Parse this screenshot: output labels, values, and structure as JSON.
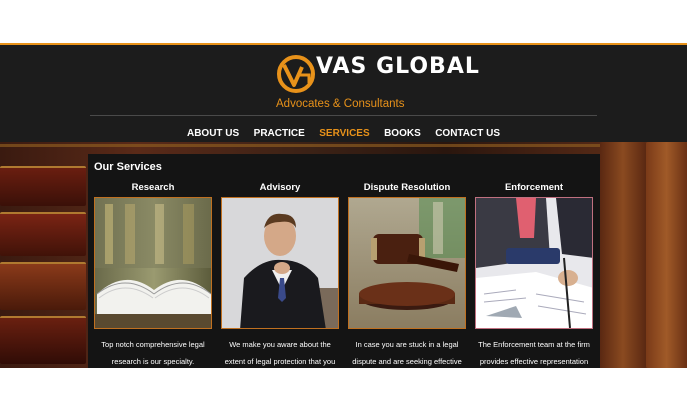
{
  "brand": {
    "name": "VAS GLOBAL",
    "tagline": "Advocates & Consultants",
    "accent": "#e8921a"
  },
  "nav": {
    "items": [
      {
        "label": "ABOUT US"
      },
      {
        "label": "PRACTICE"
      },
      {
        "label": "SERVICES",
        "active": true
      },
      {
        "label": "BOOKS"
      },
      {
        "label": "CONTACT US"
      }
    ]
  },
  "services": {
    "heading": "Our Services",
    "cards": [
      {
        "title": "Research",
        "line1": "Top notch comprehensive legal",
        "line2": "research is our specialty."
      },
      {
        "title": "Advisory",
        "line1": "We make you aware about the",
        "line2": "extent of legal protection that you"
      },
      {
        "title": "Dispute Resolution",
        "line1": "In case you are stuck in a legal",
        "line2": "dispute and are seeking effective"
      },
      {
        "title": "Enforcement",
        "line1": "The Enforcement team at the firm",
        "line2": "provides effective representation"
      }
    ]
  }
}
